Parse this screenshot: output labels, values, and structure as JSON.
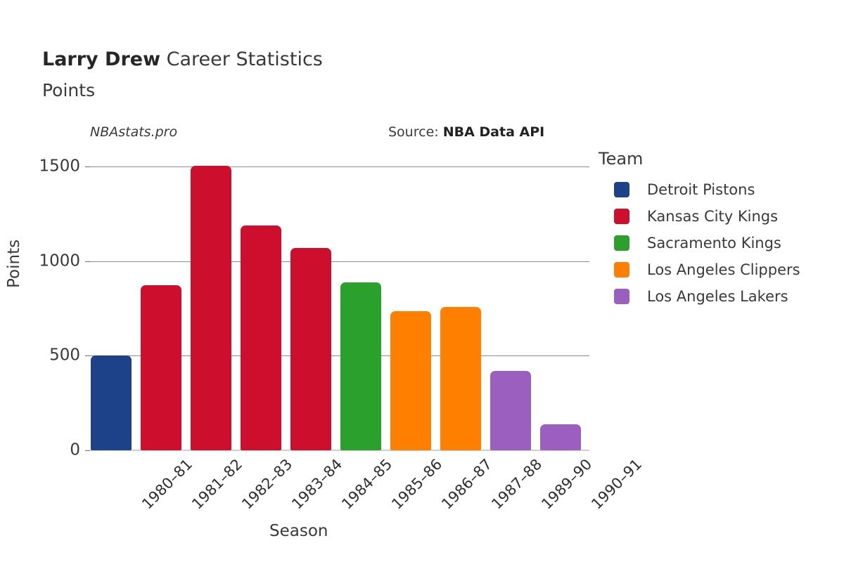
{
  "header": {
    "player_name": "Larry Drew",
    "title_rest": " Career Statistics",
    "subtitle": "Points"
  },
  "watermark": "NBAstats.pro",
  "source": {
    "label": "Source: ",
    "value": "NBA Data API"
  },
  "legend": {
    "title": "Team",
    "items": [
      {
        "label": "Detroit Pistons",
        "color": "#1d4289"
      },
      {
        "label": "Kansas City Kings",
        "color": "#ce0e2d"
      },
      {
        "label": "Sacramento Kings",
        "color": "#2ca02c"
      },
      {
        "label": "Los Angeles Clippers",
        "color": "#ff8000"
      },
      {
        "label": "Los Angeles Lakers",
        "color": "#9b5fc0"
      }
    ]
  },
  "chart_data": {
    "type": "bar",
    "title": "Larry Drew Career Statistics",
    "subtitle": "Points",
    "xlabel": "Season",
    "ylabel": "Points",
    "ylim": [
      0,
      1550
    ],
    "yticks": [
      0,
      500,
      1000,
      1500
    ],
    "ytick_labels": [
      "0",
      "500",
      "1000",
      "1500"
    ],
    "grid": true,
    "legend_position": "right",
    "legend_title": "Team",
    "categories": [
      "1980–81",
      "1981–82",
      "1982–83",
      "1983–84",
      "1984–85",
      "1985–86",
      "1986–87",
      "1987–88",
      "1989–90",
      "1990–91"
    ],
    "values": [
      500,
      875,
      1505,
      1190,
      1070,
      890,
      737,
      760,
      420,
      137
    ],
    "bar_teams": [
      "Detroit Pistons",
      "Kansas City Kings",
      "Kansas City Kings",
      "Kansas City Kings",
      "Kansas City Kings",
      "Sacramento Kings",
      "Los Angeles Clippers",
      "Los Angeles Clippers",
      "Los Angeles Lakers",
      "Los Angeles Lakers"
    ],
    "bar_colors": [
      "#1d4289",
      "#ce0e2d",
      "#ce0e2d",
      "#ce0e2d",
      "#ce0e2d",
      "#2ca02c",
      "#ff8000",
      "#ff8000",
      "#9b5fc0",
      "#9b5fc0"
    ]
  }
}
